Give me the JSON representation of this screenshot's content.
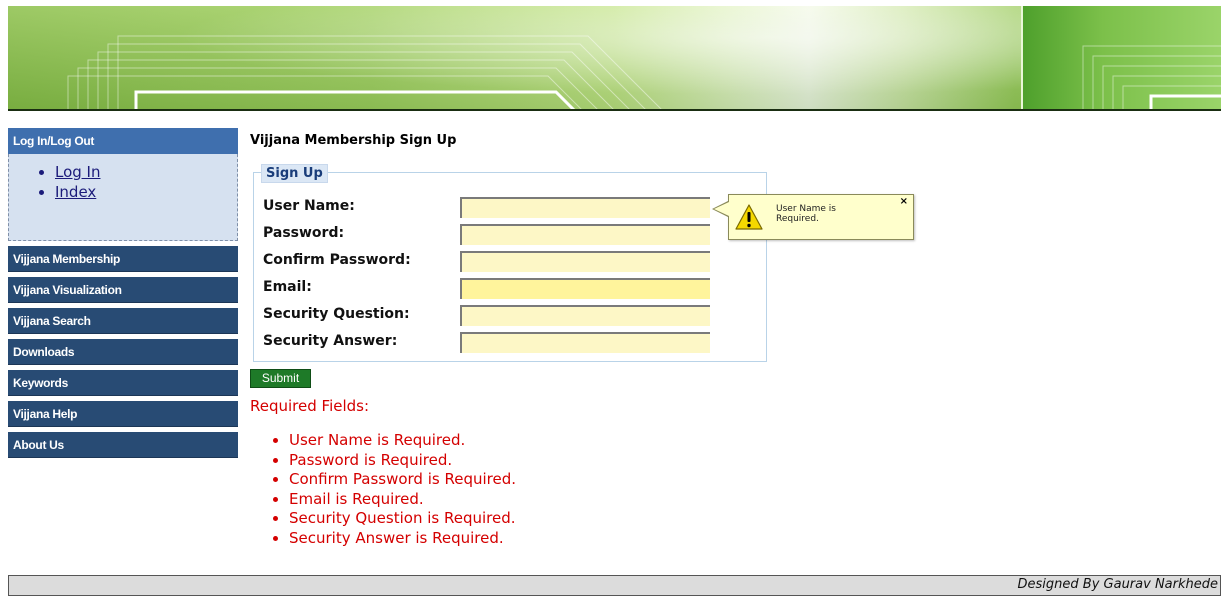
{
  "sidebar": {
    "header": "Log In/Log Out",
    "links": [
      "Log In",
      "Index"
    ],
    "nav": [
      "Vijjana Membership",
      "Vijjana Visualization",
      "Vijjana Search",
      "Downloads",
      "Keywords",
      "Vijjana Help",
      "About Us"
    ]
  },
  "main": {
    "title": "Vijjana Membership Sign Up",
    "fieldset_legend": "Sign Up",
    "fields": [
      {
        "label": "User Name:",
        "value": ""
      },
      {
        "label": "Password:",
        "value": ""
      },
      {
        "label": "Confirm Password:",
        "value": ""
      },
      {
        "label": "Email:",
        "value": ""
      },
      {
        "label": "Security Question:",
        "value": ""
      },
      {
        "label": "Security Answer:",
        "value": ""
      }
    ],
    "submit_label": "Submit"
  },
  "tooltip": {
    "text": "User Name is Required.",
    "close": "×",
    "icon": "warning-icon"
  },
  "errors": {
    "heading": "Required Fields:",
    "items": [
      "User Name is Required.",
      "Password is Required.",
      "Confirm Password is Required.",
      "Email is Required.",
      "Security Question is Required.",
      "Security Answer is Required."
    ]
  },
  "footer": {
    "text": "Designed By Gaurav Narkhede"
  },
  "colors": {
    "nav_bg": "#284b74",
    "nav_header_bg": "#3f6fae",
    "error": "#d40000",
    "submit_bg": "#1e7a28",
    "input_bg": "#fdf7c6"
  }
}
